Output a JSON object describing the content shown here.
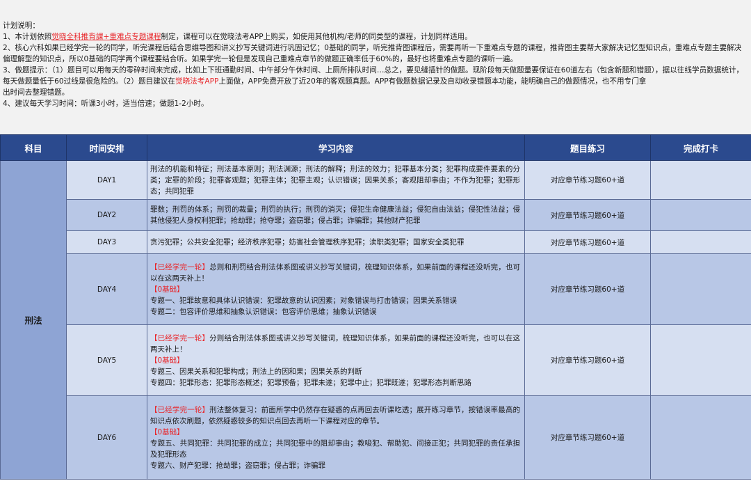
{
  "notes": {
    "title": "计划说明：",
    "l1_pre": "1、本计划依照",
    "l1_link": "觉晓全科推背課+重难点专题课程",
    "l1_post": "制定，课程可以在觉晓法考APP上购买，如使用其他机构/老师的同类型的课程，计划同样适用。",
    "l2": "2、核心六科如果已经学完一轮的同学，听完课程后结合思维导图和讲义抄写关键词进行巩固记忆；0基础的同学，听完推背图课程后，需要再听一下重难点专题的课程，推背图主要帮大家解决记忆型知识点，重难点专题主要解决偏理解型的知识点，所以0基础的同学两个课程要结合听。如果学完一轮但是发现自己重难点章节的做题正确率低于60%的，最好也将重难点专题的课听一遍。",
    "l3_pre": "3、做题提示：（1）题目可以用每天的零碎时间来完成，比如上下班通勤时间、中午部分午休时间、上厕所排队时间…总之，要见缝插针的做题。现阶段每天做题量要保证在60道左右（包含新题和错题），据以往线学员数据统计，每天做题量低于60过线是很危险的。（2）题目建议在",
    "l3_link": "觉晓法考APP",
    "l3_post": "上面做，APP免费开放了近20年的客观题真题。APP有做题数据记录及自动收录错题本功能，能明确自己的做题情况，也不用专门拿",
    "l3_cont": "出时间去整理错题。",
    "l4": "4、建议每天学习时间：听课3小时，适当倍速；做题1-2小时。"
  },
  "table": {
    "headers": [
      "科目",
      "时间安排",
      "学习内容",
      "题目练习",
      "完成打卡"
    ],
    "subject": "刑法",
    "rows": [
      {
        "day": "DAY1",
        "content": "刑法的机能和特征；刑法基本原则；刑法渊源；刑法的解释；刑法的效力；犯罪基本分类；犯罪构成要件要素的分类；定罪的阶段；犯罪客观题；犯罪主体；犯罪主观；认识错误；因果关系；客观阻却事由；不作为犯罪；犯罪形态；共同犯罪",
        "exercise": "对应章节练习题60+道"
      },
      {
        "day": "DAY2",
        "content": "罪数；刑罚的体系；刑罚的裁量；刑罚的执行；刑罚的消灭；侵犯生命健康法益；侵犯自由法益；侵犯性法益；侵其他侵犯人身权利犯罪；抢劫罪；抢夺罪；盗窃罪；侵占罪；诈骗罪；其他财产犯罪",
        "exercise": "对应章节练习题60+道"
      },
      {
        "day": "DAY3",
        "content": "贪污犯罪；公共安全犯罪；经济秩序犯罪；妨害社会管理秩序犯罪；渎职类犯罪；国家安全类犯罪",
        "exercise": "对应章节练习题60+道"
      },
      {
        "day": "DAY4",
        "tag1": "【已经学完一轮】",
        "text1": "总则和刑罚结合刑法体系图或讲义抄写关键词，梳理知识体系，如果前面的课程还没听完，也可以在这两天补上！",
        "tag2": "【0基础】",
        "lines": [
          "专题一、犯罪故意和具体认识错误：犯罪故意的认识因素；对象错误与打击错误；因果关系错误",
          "专题二：包容评价思维和抽象认识错误：包容评价思维；抽象认识错误"
        ],
        "exercise": "对应章节练习题60+道"
      },
      {
        "day": "DAY5",
        "tag1": "【已经学完一轮】",
        "text1": "分则结合刑法体系图或讲义抄写关键词，梳理知识体系，如果前面的课程还没听完，也可以在这两天补上！",
        "tag2": "【0基础】",
        "lines": [
          "专题三、因果关系和犯罪构成；刑法上的因和果；因果关系的判断",
          "专题四：犯罪形态：犯罪形态概述；犯罪预备；犯罪未遂；犯罪中止；犯罪既遂；犯罪形态判断思路"
        ],
        "exercise": "对应章节练习题60+道"
      },
      {
        "day": "DAY6",
        "tag1": "【已经学完一轮】",
        "text1": "刑法整体复习：前面所学中仍然存在疑惑的点再回去听课吃透；展开练习章节，按错误率最高的知识点依次刷题，依然疑惑较多的知识点回去再听一下课程对应的章节。",
        "tag2": "【0基础】",
        "lines": [
          "专题五、共同犯罪：共同犯罪的成立；共同犯罪中的阻却事由；教唆犯、帮助犯、间接正犯；共同犯罪的责任承担及犯罪形态",
          "专题六、财产犯罪：抢劫罪；盗窃罪；侵占罪；诈骗罪"
        ],
        "exercise": "对应章节练习题60+道"
      }
    ]
  }
}
